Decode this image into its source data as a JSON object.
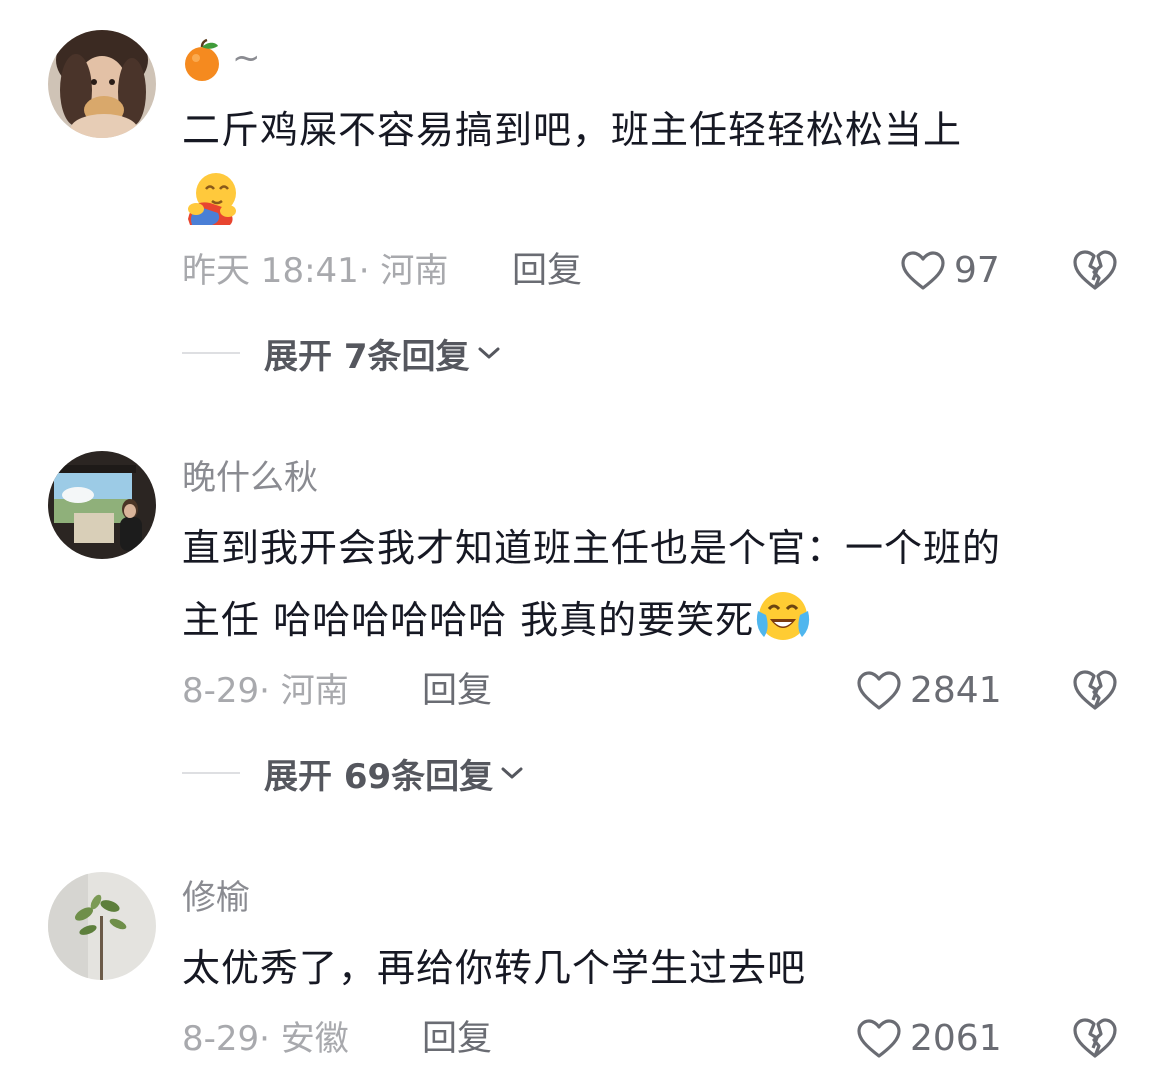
{
  "comments": [
    {
      "username": "~",
      "username_emoji": "orange-emoji",
      "text": "二斤鸡屎不容易搞到吧，班主任轻轻松松当上",
      "trailing_emoji": "hug-emoji",
      "time_location": "昨天 18:41· 河南",
      "reply_label": "回复",
      "likes": "97",
      "expand_label": "展开 7条回复"
    },
    {
      "username": "晚什么秋",
      "text_line1": "直到我开会我才知道班主任也是个官：一个班的",
      "text_line2": "主任 哈哈哈哈哈哈 我真的要笑死",
      "trailing_emoji": "crying-laughing-emoji",
      "time_location": "8-29· 河南",
      "reply_label": "回复",
      "likes": "2841",
      "expand_label": "展开 69条回复"
    },
    {
      "username": "修榆",
      "text": "太优秀了，再给你转几个学生过去吧",
      "time_location": "8-29· 安徽",
      "reply_label": "回复",
      "likes": "2061"
    }
  ],
  "colors": {
    "text_primary": "#161823",
    "text_secondary": "#8a8b91",
    "meta": "#a8a9ad",
    "icon_stroke": "#6a6c73"
  }
}
